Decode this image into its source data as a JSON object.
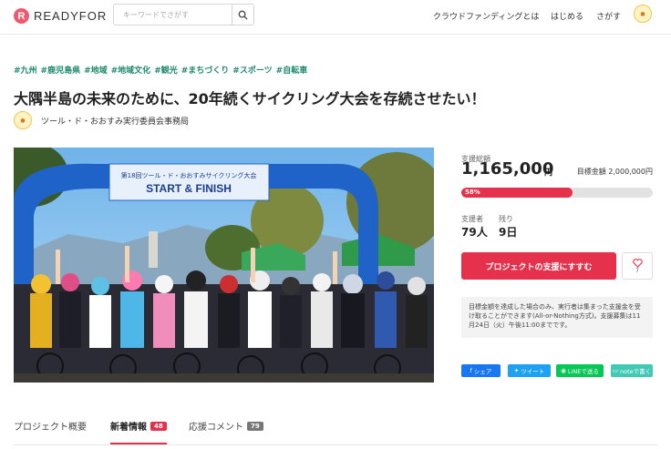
{
  "header": {
    "logo_text": "READYFOR",
    "search_placeholder": "キーワードでさがす",
    "nav": [
      "クラウドファンディングとは",
      "はじめる",
      "さがす"
    ],
    "accent": "#ed5a6f"
  },
  "project": {
    "tags": [
      "#九州",
      "#鹿児島県",
      "#地域",
      "#地域文化",
      "#観光",
      "#まちづくり",
      "#スポーツ",
      "#自転車"
    ],
    "title": "大隅半島の未来のために、20年続くサイクリング大会を存続させたい！",
    "owner": "ツール・ド・おおすみ実行委員会事務局",
    "image": {
      "banner_line1": "第18回ツール・ド・おおすみサイクリング大会",
      "banner_line2": "START & FINISH"
    }
  },
  "funding": {
    "raised_label": "支援総額",
    "raised_amount": "1,165,000",
    "raised_unit": "円",
    "goal_text": "目標金額 2,000,000円",
    "progress_percent_text": "58%",
    "progress_fraction": 0.58,
    "supporters_label": "支援者",
    "supporters_value": "79人",
    "remaining_label": "残り",
    "remaining_value": "9日",
    "support_button": "プロジェクトの支援にすすむ",
    "fav_count": "7",
    "notice": "目標金額を達成した場合のみ、実行者は集まった支援金を受け取ることができます(All-or-Nothing方式)。支援募集は11月24日（火）午後11:00までです。"
  },
  "share": [
    {
      "label": "シェア",
      "color": "#1877f2"
    },
    {
      "label": "ツイート",
      "color": "#1da1f2"
    },
    {
      "label": "LINEで送る",
      "color": "#06c755"
    },
    {
      "label": "noteで書く",
      "color": "#41c9b4"
    }
  ],
  "tabs": [
    {
      "label": "プロジェクト概要",
      "badge": ""
    },
    {
      "label": "新着情報",
      "badge": "48",
      "badge_color": "#e6314c"
    },
    {
      "label": "応援コメント",
      "badge": "79",
      "badge_color": "#777777"
    }
  ]
}
